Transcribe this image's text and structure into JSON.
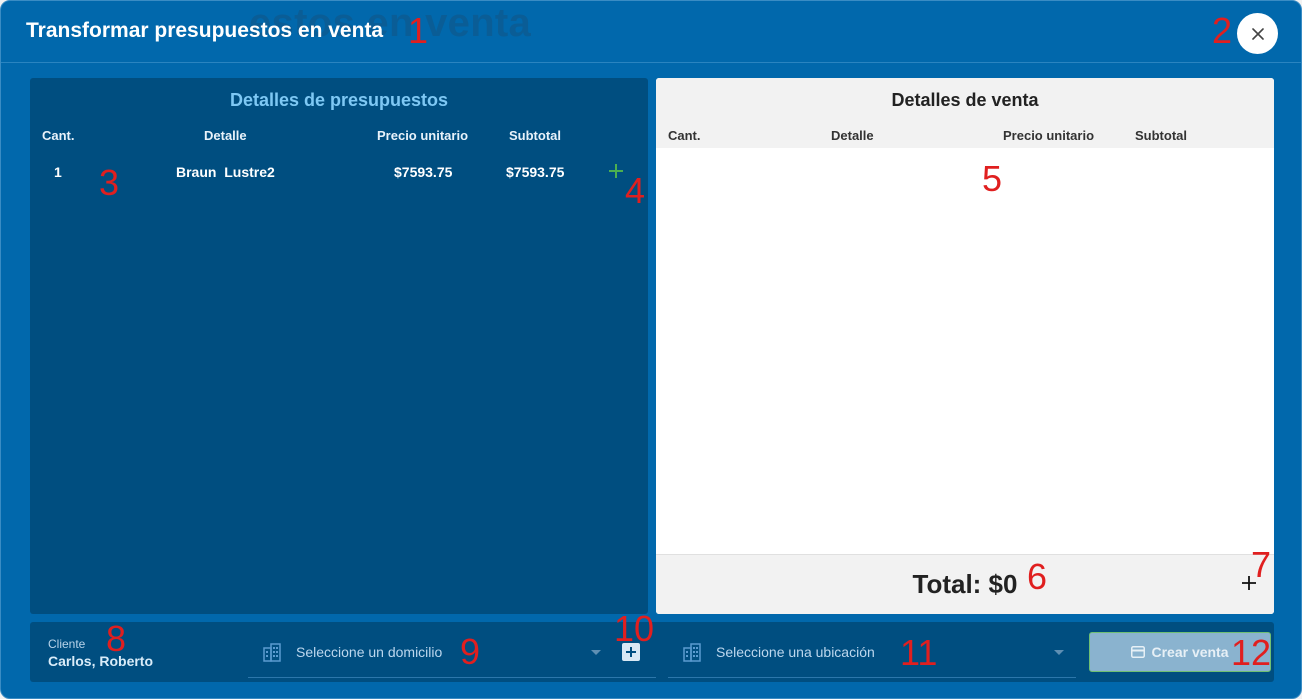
{
  "dialog": {
    "background_title": "estos en venta",
    "title": "Transformar presupuestos en venta",
    "close_icon": "close-icon"
  },
  "left_panel": {
    "title": "Detalles de presupuestos",
    "columns": [
      "Cant.",
      "Detalle",
      "Precio unitario",
      "Subtotal"
    ],
    "rows": [
      {
        "qty": "1",
        "detail": "Braun  Lustre2",
        "unit_price": "$7593.75",
        "subtotal": "$7593.75"
      }
    ],
    "add_icon": "plus-icon",
    "add_color": "#4caf50"
  },
  "right_panel": {
    "title": "Detalles de venta",
    "columns": [
      "Cant.",
      "Detalle",
      "Precio unitario",
      "Subtotal"
    ],
    "rows": [],
    "total": "Total: $0",
    "add_icon": "plus-icon"
  },
  "bottom": {
    "client_label": "Cliente",
    "client_name": "Carlos, Roberto",
    "address_placeholder": "Seleccione un domicilio",
    "location_placeholder": "Seleccione una ubicación",
    "create_label": "Crear venta",
    "create_icon": "credit-card-icon",
    "building_icon": "building-icon",
    "add_address_icon": "plus-box-icon"
  },
  "annotations": [
    "1",
    "2",
    "3",
    "4",
    "5",
    "6",
    "7",
    "8",
    "9",
    "10",
    "11",
    "12"
  ],
  "colors": {
    "dialog_bg": "#0168ac",
    "panel_bg": "#004e80",
    "accent_title": "#7ec8f4",
    "annotation": "#e01f1f"
  }
}
